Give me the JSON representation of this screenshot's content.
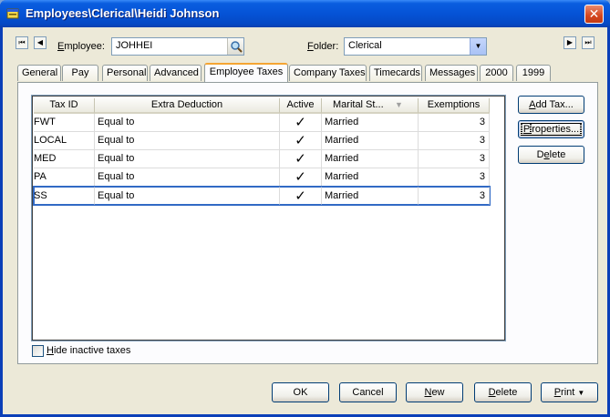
{
  "window": {
    "title": "Employees\\Clerical\\Heidi Johnson",
    "close_glyph": "✕"
  },
  "nav": {
    "first_glyph": "⏮",
    "prev_glyph": "◀",
    "next_glyph": "▶",
    "last_glyph": "⏭"
  },
  "employee": {
    "label_accel": "E",
    "label_rest": "mployee:",
    "value": "JOHHEI"
  },
  "folder": {
    "label_accel": "F",
    "label_rest": "older:",
    "value": "Clerical"
  },
  "tabs": [
    {
      "label": "General"
    },
    {
      "label": "Pay"
    },
    {
      "label": "Personal"
    },
    {
      "label": "Advanced"
    },
    {
      "label": "Employee Taxes"
    },
    {
      "label": "Company Taxes"
    },
    {
      "label": "Timecards"
    },
    {
      "label": "Messages"
    },
    {
      "label": "2000"
    },
    {
      "label": "1999"
    }
  ],
  "active_tab": "Employee Taxes",
  "grid": {
    "columns": [
      "Tax ID",
      "Extra Deduction",
      "Active",
      "Marital St...",
      "Exemptions"
    ],
    "rows": [
      {
        "tax_id": "FWT",
        "extra": "Equal to",
        "active": "✓",
        "marital": "Married",
        "exemptions": "3"
      },
      {
        "tax_id": "LOCAL",
        "extra": "Equal to",
        "active": "✓",
        "marital": "Married",
        "exemptions": "3"
      },
      {
        "tax_id": "MED",
        "extra": "Equal to",
        "active": "✓",
        "marital": "Married",
        "exemptions": "3"
      },
      {
        "tax_id": "PA",
        "extra": "Equal to",
        "active": "✓",
        "marital": "Married",
        "exemptions": "3"
      },
      {
        "tax_id": "SS",
        "extra": "Equal to",
        "active": "✓",
        "marital": "Married",
        "exemptions": "3"
      }
    ]
  },
  "side_buttons": {
    "add": {
      "accel": "A",
      "rest": "dd Tax..."
    },
    "properties": {
      "accel": "P",
      "rest": "roperties..."
    },
    "delete": {
      "pre": "D",
      "accel": "e",
      "rest": "lete"
    }
  },
  "hide_inactive": {
    "accel": "H",
    "rest": "ide inactive taxes",
    "checked": false
  },
  "bottom_buttons": {
    "ok": "OK",
    "cancel": "Cancel",
    "new": {
      "accel": "N",
      "rest": "ew"
    },
    "delete": {
      "accel": "D",
      "rest": "elete"
    },
    "print": {
      "accel": "P",
      "rest": "rint"
    }
  },
  "colors": {
    "titlebar": "#0553d6",
    "window_bg": "#ece9d8",
    "tab_accent": "#f5a533",
    "selection": "#316ac5"
  }
}
